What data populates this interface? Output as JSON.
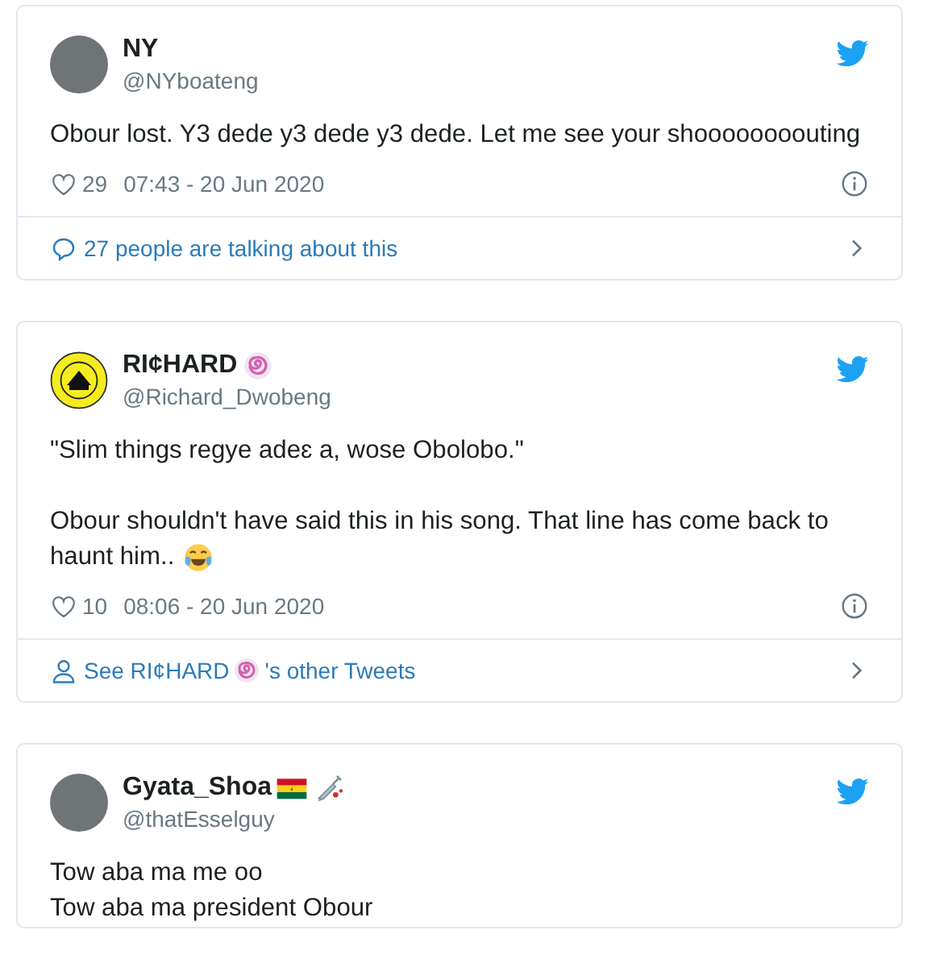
{
  "tweets": [
    {
      "name": "NY",
      "handle": "@NYboateng",
      "avatar": {
        "kind": "photo"
      },
      "paragraphs": [
        [
          "Obour lost. Y3 dede y3 dede y3 dede. Let me see your shoooooooouting"
        ]
      ],
      "text_emoji": false,
      "likes": "29",
      "timestamp": "07:43 - 20 Jun 2020",
      "footer": {
        "kind": "conversation",
        "text": "27 people are talking about this"
      }
    },
    {
      "name": "RI¢HARD",
      "name_icons": [
        {
          "kind": "swirl"
        }
      ],
      "handle": "@Richard_Dwobeng",
      "avatar": {
        "kind": "badge"
      },
      "paragraphs": [
        [
          "\"Slim things regye adeɛ a, wose Obolobo.\""
        ],
        [
          "Obour shouldn't have said this in his song. That line has come back to",
          "haunt him.."
        ]
      ],
      "text_emoji": true,
      "likes": "10",
      "timestamp": "08:06 - 20 Jun 2020",
      "footer": {
        "kind": "profile",
        "text": "See RI¢HARD",
        "suffix": "'s other Tweets"
      }
    },
    {
      "name": "Gyata_Shoa",
      "name_icons": [
        {
          "kind": "flag"
        },
        {
          "kind": "syringe"
        }
      ],
      "handle": "@thatEsselguy",
      "avatar": {
        "kind": "photo"
      },
      "paragraphs": [
        [
          "Tow aba ma me oo",
          "Tow aba ma president Obour"
        ]
      ],
      "text_emoji": false
    }
  ]
}
